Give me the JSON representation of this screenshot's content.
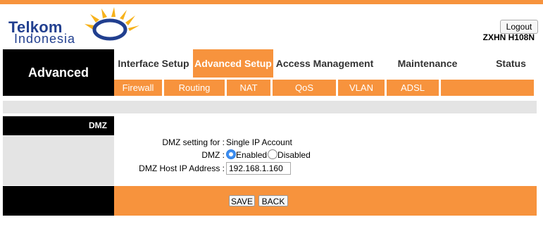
{
  "brand": {
    "line1": "Telkom",
    "line2": "Indonesia",
    "sun_color": "#f7b21b",
    "text_color": "#213f8f"
  },
  "header": {
    "logout_label": "Logout",
    "model": "ZXHN H108N"
  },
  "nav": {
    "section_title": "Advanced",
    "main_tabs": [
      {
        "label": "Interface Setup",
        "active": false
      },
      {
        "label": "Advanced Setup",
        "active": true
      },
      {
        "label": "Access Management",
        "active": false
      },
      {
        "label": "Maintenance",
        "active": false
      },
      {
        "label": "Status",
        "active": false
      }
    ],
    "sub_tabs": [
      "Firewall",
      "Routing",
      "NAT",
      "QoS",
      "VLAN",
      "ADSL"
    ]
  },
  "section": {
    "title": "DMZ"
  },
  "form": {
    "setting_for_label": "DMZ setting for :",
    "setting_for_value": "Single IP Account",
    "dmz_label": "DMZ :",
    "enabled_label": "Enabled",
    "disabled_label": "Disabled",
    "dmz_selected": "Enabled",
    "host_ip_label": "DMZ Host IP Address :",
    "host_ip_value": "192.168.1.160"
  },
  "actions": {
    "save_label": "SAVE",
    "back_label": "BACK"
  },
  "colors": {
    "accent": "#f7933d",
    "dark": "#000000",
    "panel_grey": "#e4e4e4"
  }
}
